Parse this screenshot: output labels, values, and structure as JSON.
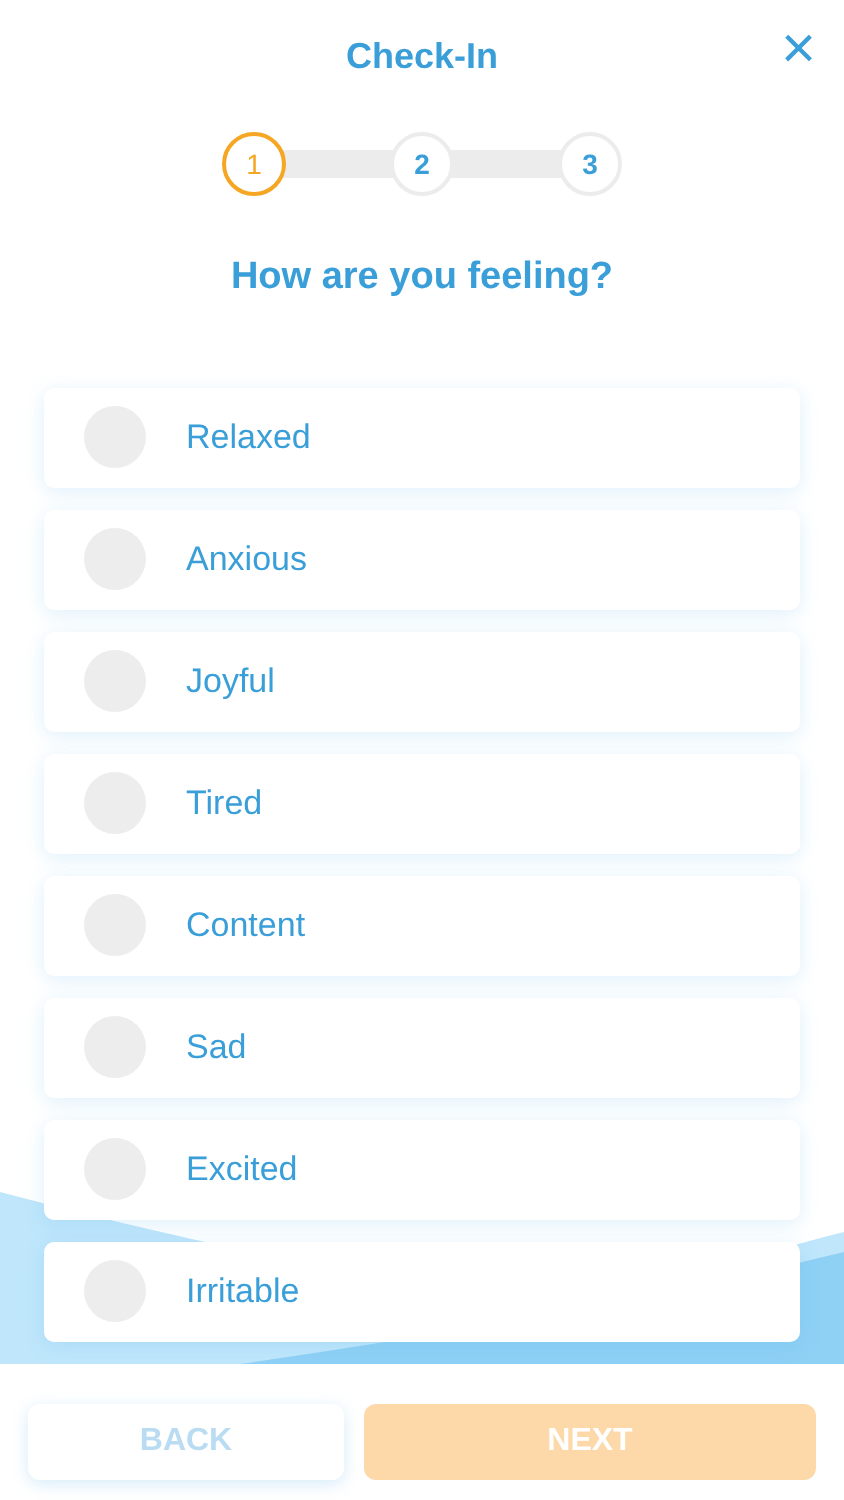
{
  "header": {
    "title": "Check-In",
    "close": "×"
  },
  "steps": [
    {
      "label": "1",
      "selected": true
    },
    {
      "label": "2",
      "selected": false
    },
    {
      "label": "3",
      "selected": false
    }
  ],
  "question": "How are you feeling?",
  "options": [
    {
      "label": "Relaxed",
      "selected": false
    },
    {
      "label": "Anxious",
      "selected": false
    },
    {
      "label": "Joyful",
      "selected": false
    },
    {
      "label": "Tired",
      "selected": false
    },
    {
      "label": "Content",
      "selected": false
    },
    {
      "label": "Sad",
      "selected": false
    },
    {
      "label": "Excited",
      "selected": false
    },
    {
      "label": "Irritable",
      "selected": false
    }
  ],
  "buttons": [
    {
      "label": "BACK",
      "kind": "back",
      "disabled": true
    },
    {
      "label": "NEXT",
      "kind": "next",
      "disabled": true
    }
  ]
}
